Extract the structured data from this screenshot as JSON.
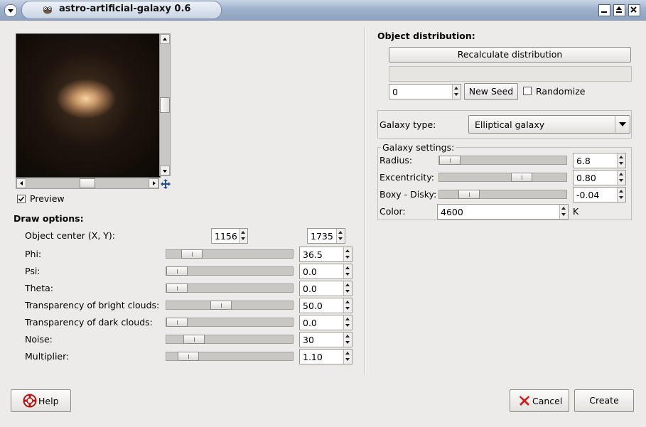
{
  "window": {
    "title": "astro-artificial-galaxy 0.6"
  },
  "preview": {
    "checkbox_label": "Preview",
    "checked": true
  },
  "draw_options": {
    "heading": "Draw options:",
    "object_center": {
      "label": "Object center (X, Y):",
      "x": "1156",
      "y": "1735"
    },
    "sliders": [
      {
        "label": "Phi:",
        "value": "36.5",
        "fraction": 0.14
      },
      {
        "label": "Psi:",
        "value": "0.0",
        "fraction": 0.0
      },
      {
        "label": "Theta:",
        "value": "0.0",
        "fraction": 0.0
      },
      {
        "label": "Transparency of bright clouds:",
        "value": "50.0",
        "fraction": 0.42
      },
      {
        "label": "Transparency of dark clouds:",
        "value": "0.0",
        "fraction": 0.0
      },
      {
        "label": "Noise:",
        "value": "30",
        "fraction": 0.16
      },
      {
        "label": "Multiplier:",
        "value": "1.10",
        "fraction": 0.11
      }
    ]
  },
  "object_distribution": {
    "heading": "Object distribution:",
    "recalculate_label": "Recalculate distribution",
    "seed_value": "0",
    "new_seed_label": "New Seed",
    "randomize_label": "Randomize",
    "randomize_checked": false
  },
  "galaxy_type": {
    "label": "Galaxy type:",
    "selected": "Elliptical galaxy"
  },
  "galaxy_settings": {
    "legend": "Galaxy settings:",
    "sliders": [
      {
        "label": "Radius:",
        "value": "6.8",
        "fraction": 0.0
      },
      {
        "label": "Excentricity:",
        "value": "0.80",
        "fraction": 0.68
      },
      {
        "label": "Boxy - Disky:",
        "value": "-0.04",
        "fraction": 0.18
      }
    ],
    "color": {
      "label": "Color:",
      "value": "4600",
      "unit": "K"
    }
  },
  "footer": {
    "help_label": "Help",
    "cancel_label": "Cancel",
    "create_label": "Create"
  }
}
